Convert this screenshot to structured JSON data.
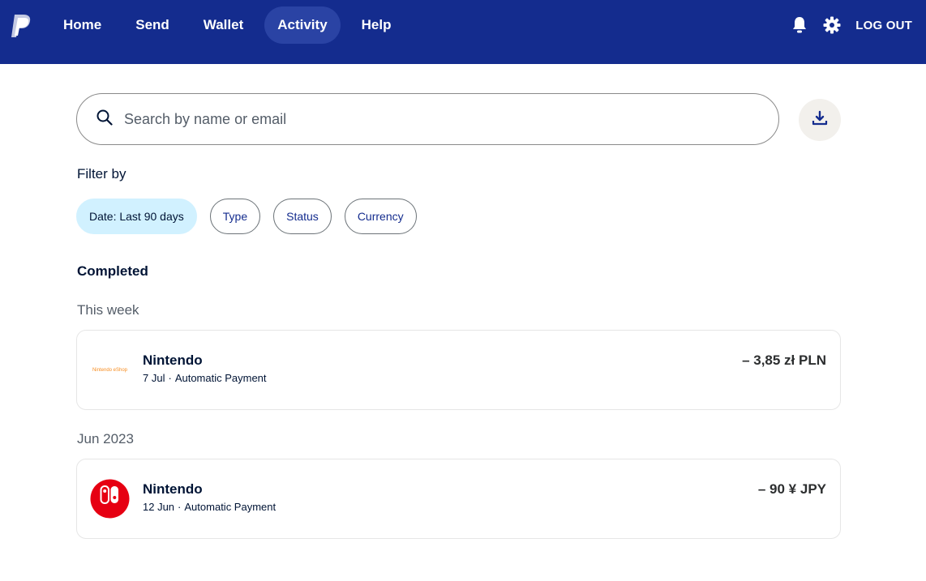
{
  "nav": {
    "items": [
      {
        "label": "Home",
        "active": false
      },
      {
        "label": "Send",
        "active": false
      },
      {
        "label": "Wallet",
        "active": false
      },
      {
        "label": "Activity",
        "active": true
      },
      {
        "label": "Help",
        "active": false
      }
    ],
    "logout_label": "LOG OUT"
  },
  "icons": {
    "logo": "paypal-logo",
    "notifications": "bell-icon",
    "settings": "gear-icon",
    "search": "search-icon",
    "download": "download-icon"
  },
  "search": {
    "placeholder": "Search by name or email",
    "value": ""
  },
  "filters": {
    "label": "Filter by",
    "chips": [
      {
        "label": "Date: Last 90 days",
        "selected": true
      },
      {
        "label": "Type",
        "selected": false
      },
      {
        "label": "Status",
        "selected": false
      },
      {
        "label": "Currency",
        "selected": false
      }
    ]
  },
  "activity": {
    "section_title": "Completed",
    "groups": [
      {
        "label": "This week",
        "transactions": [
          {
            "merchant": "Nintendo",
            "date": "7 Jul",
            "dot": "·",
            "type": "Automatic Payment",
            "amount": "– 3,85 zł PLN",
            "logo_text": "Nintendo eShop"
          }
        ]
      },
      {
        "label": "Jun 2023",
        "transactions": [
          {
            "merchant": "Nintendo",
            "date": "12 Jun",
            "dot": "·",
            "type": "Automatic Payment",
            "amount": "– 90 ¥ JPY",
            "logo_text": "NINTENDO SWITCH"
          }
        ]
      }
    ]
  },
  "colors": {
    "header_bg": "#142c8e",
    "nav_active_bg": "#2a43a4",
    "chip_selected_bg": "#d1f1ff",
    "switch_red": "#e60012",
    "eshop_orange": "#f78c1f"
  }
}
